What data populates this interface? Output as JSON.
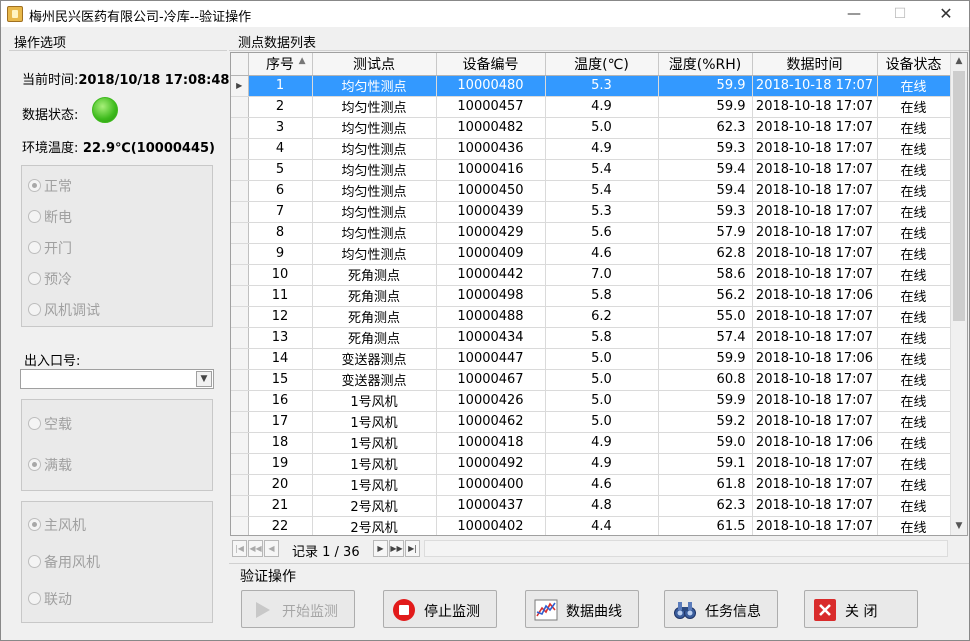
{
  "window": {
    "title": "梅州民兴医药有限公司-冷库--验证操作",
    "minimize": "—",
    "maximize": "☐",
    "close": "✕"
  },
  "left": {
    "header": "操作选项",
    "time_label": "当前时间:",
    "time_value": "2018/10/18 17:08:48",
    "status_label": "数据状态:",
    "status_color": "#3dba1c",
    "env_label": "环境温度:",
    "env_value": "22.9℃(10000445)",
    "mode_options": [
      "正常",
      "断电",
      "开门",
      "预冷",
      "风机调试"
    ],
    "mode_selected": "正常",
    "port_label": "出入口号:",
    "port_value": "",
    "load_options": [
      "空载",
      "满载"
    ],
    "load_selected": "满载",
    "fan_options": [
      "主风机",
      "备用风机",
      "联动"
    ],
    "fan_selected": "主风机"
  },
  "grid": {
    "title": "测点数据列表",
    "columns": [
      "序号",
      "测试点",
      "设备编号",
      "温度(℃)",
      "湿度(%RH)",
      "数据时间",
      "设备状态"
    ],
    "rows": [
      [
        "1",
        "均匀性测点",
        "10000480",
        "5.3",
        "59.9",
        "2018-10-18 17:07",
        "在线"
      ],
      [
        "2",
        "均匀性测点",
        "10000457",
        "4.9",
        "59.9",
        "2018-10-18 17:07",
        "在线"
      ],
      [
        "3",
        "均匀性测点",
        "10000482",
        "5.0",
        "62.3",
        "2018-10-18 17:07",
        "在线"
      ],
      [
        "4",
        "均匀性测点",
        "10000436",
        "4.9",
        "59.3",
        "2018-10-18 17:07",
        "在线"
      ],
      [
        "5",
        "均匀性测点",
        "10000416",
        "5.4",
        "59.4",
        "2018-10-18 17:07",
        "在线"
      ],
      [
        "6",
        "均匀性测点",
        "10000450",
        "5.4",
        "59.4",
        "2018-10-18 17:07",
        "在线"
      ],
      [
        "7",
        "均匀性测点",
        "10000439",
        "5.3",
        "59.3",
        "2018-10-18 17:07",
        "在线"
      ],
      [
        "8",
        "均匀性测点",
        "10000429",
        "5.6",
        "57.9",
        "2018-10-18 17:07",
        "在线"
      ],
      [
        "9",
        "均匀性测点",
        "10000409",
        "4.6",
        "62.8",
        "2018-10-18 17:07",
        "在线"
      ],
      [
        "10",
        "死角测点",
        "10000442",
        "7.0",
        "58.6",
        "2018-10-18 17:07",
        "在线"
      ],
      [
        "11",
        "死角测点",
        "10000498",
        "5.8",
        "56.2",
        "2018-10-18 17:06",
        "在线"
      ],
      [
        "12",
        "死角测点",
        "10000488",
        "6.2",
        "55.0",
        "2018-10-18 17:07",
        "在线"
      ],
      [
        "13",
        "死角测点",
        "10000434",
        "5.8",
        "57.4",
        "2018-10-18 17:07",
        "在线"
      ],
      [
        "14",
        "变送器测点",
        "10000447",
        "5.0",
        "59.9",
        "2018-10-18 17:06",
        "在线"
      ],
      [
        "15",
        "变送器测点",
        "10000467",
        "5.0",
        "60.8",
        "2018-10-18 17:07",
        "在线"
      ],
      [
        "16",
        "1号风机",
        "10000426",
        "5.0",
        "59.9",
        "2018-10-18 17:07",
        "在线"
      ],
      [
        "17",
        "1号风机",
        "10000462",
        "5.0",
        "59.2",
        "2018-10-18 17:07",
        "在线"
      ],
      [
        "18",
        "1号风机",
        "10000418",
        "4.9",
        "59.0",
        "2018-10-18 17:06",
        "在线"
      ],
      [
        "19",
        "1号风机",
        "10000492",
        "4.9",
        "59.1",
        "2018-10-18 17:07",
        "在线"
      ],
      [
        "20",
        "1号风机",
        "10000400",
        "4.6",
        "61.8",
        "2018-10-18 17:07",
        "在线"
      ],
      [
        "21",
        "2号风机",
        "10000437",
        "4.8",
        "62.3",
        "2018-10-18 17:07",
        "在线"
      ],
      [
        "22",
        "2号风机",
        "10000402",
        "4.4",
        "61.5",
        "2018-10-18 17:07",
        "在线"
      ]
    ],
    "selected_row": 0,
    "record_text": "记录 1 / 36"
  },
  "verify": {
    "title": "验证操作",
    "start_label": "开始监测",
    "stop_label": "停止监测",
    "curve_label": "数据曲线",
    "task_label": "任务信息",
    "close_label": "关 闭"
  }
}
